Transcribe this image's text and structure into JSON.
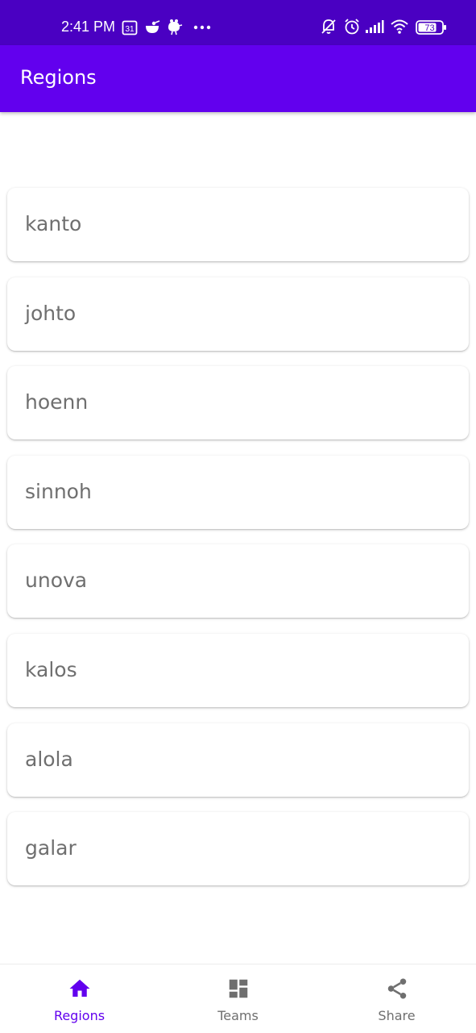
{
  "status_bar": {
    "time": "2:41 PM",
    "calendar_day": "31",
    "battery_level": "73",
    "icons_left": [
      "calendar-icon",
      "kettle-icon",
      "bird-icon",
      "more-notifications-icon"
    ],
    "icons_right": [
      "notifications-off-icon",
      "alarm-icon",
      "signal-icon",
      "wifi-icon",
      "battery-icon"
    ]
  },
  "app_bar": {
    "title": "Regions"
  },
  "regions": [
    {
      "name": "kanto"
    },
    {
      "name": "johto"
    },
    {
      "name": "hoenn"
    },
    {
      "name": "sinnoh"
    },
    {
      "name": "unova"
    },
    {
      "name": "kalos"
    },
    {
      "name": "alola"
    },
    {
      "name": "galar"
    }
  ],
  "bottom_nav": {
    "items": [
      {
        "label": "Regions",
        "icon": "home-icon",
        "active": true
      },
      {
        "label": "Teams",
        "icon": "dashboard-icon",
        "active": false
      },
      {
        "label": "Share",
        "icon": "share-icon",
        "active": false
      }
    ]
  },
  "colors": {
    "status_bar": "#4a00c2",
    "app_bar": "#6200ee",
    "nav_active": "#6200ee",
    "nav_inactive": "#6f6f6f",
    "region_text": "#6f6f6f",
    "background": "#ffffff"
  }
}
